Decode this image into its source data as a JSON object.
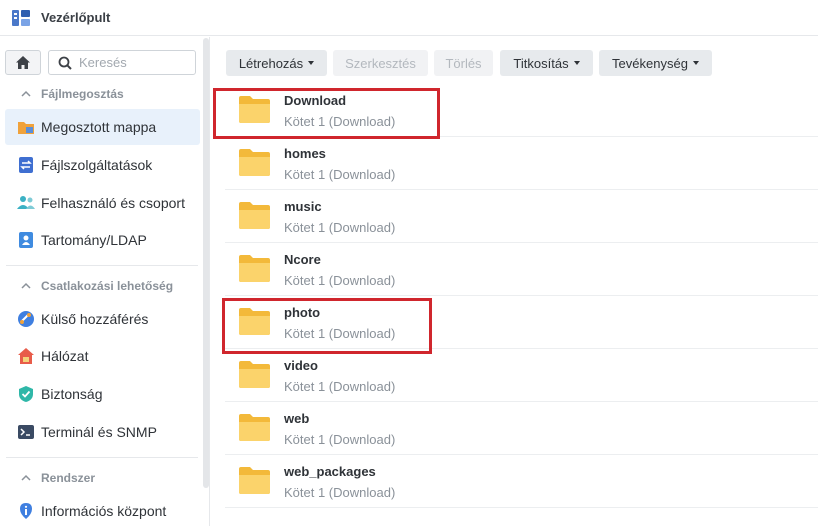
{
  "app": {
    "title": "Vezérlőpult"
  },
  "sidebar": {
    "search_placeholder": "Keresés",
    "sections": [
      {
        "title": "Fájlmegosztás",
        "items": [
          {
            "label": "Megosztott mappa",
            "icon": "shared-folder-icon",
            "active": true
          },
          {
            "label": "Fájlszolgáltatások",
            "icon": "file-services-icon"
          },
          {
            "label": "Felhasználó és csoport",
            "icon": "user-group-icon"
          },
          {
            "label": "Tartomány/LDAP",
            "icon": "domain-ldap-icon"
          }
        ]
      },
      {
        "title": "Csatlakozási lehetőség",
        "items": [
          {
            "label": "Külső hozzáférés",
            "icon": "external-access-icon"
          },
          {
            "label": "Hálózat",
            "icon": "network-icon"
          },
          {
            "label": "Biztonság",
            "icon": "security-shield-icon"
          },
          {
            "label": "Terminál és SNMP",
            "icon": "terminal-icon"
          }
        ]
      },
      {
        "title": "Rendszer",
        "items": [
          {
            "label": "Információs központ",
            "icon": "info-center-icon"
          }
        ]
      }
    ]
  },
  "toolbar": {
    "create": "Létrehozás",
    "edit": "Szerkesztés",
    "delete": "Törlés",
    "encryption": "Titkosítás",
    "action": "Tevékenység"
  },
  "folders": [
    {
      "name": "Download",
      "volume": "Kötet 1 (Download)",
      "highlighted": true
    },
    {
      "name": "homes",
      "volume": "Kötet 1 (Download)"
    },
    {
      "name": "music",
      "volume": "Kötet 1 (Download)"
    },
    {
      "name": "Ncore",
      "volume": "Kötet 1 (Download)"
    },
    {
      "name": "photo",
      "volume": "Kötet 1 (Download)",
      "highlighted": true
    },
    {
      "name": "video",
      "volume": "Kötet 1 (Download)"
    },
    {
      "name": "web",
      "volume": "Kötet 1 (Download)"
    },
    {
      "name": "web_packages",
      "volume": "Kötet 1 (Download)"
    }
  ],
  "colors": {
    "accent": "#e8f1fb",
    "folder": "#f9c84a",
    "highlight_box": "#d0262d"
  }
}
